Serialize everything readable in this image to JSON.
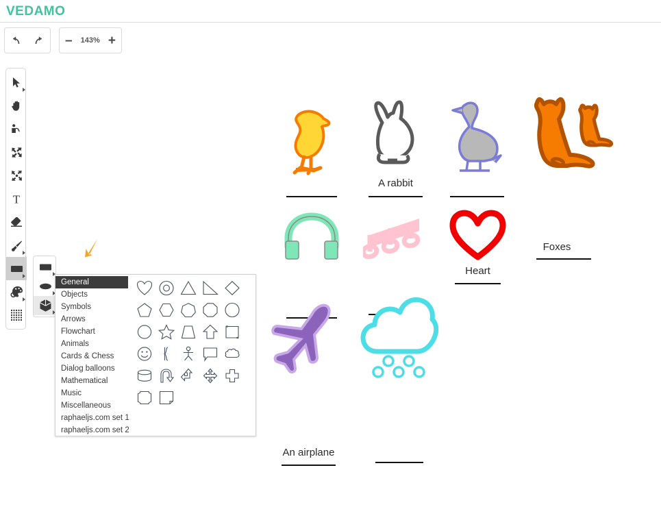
{
  "app": {
    "brand": "VEDAMO",
    "brand_color": "#3ec49f"
  },
  "toolbar": {
    "undo_label": "undo-arrow",
    "redo_label": "redo-arrow",
    "zoom_out_label": "–",
    "zoom_level": "143%",
    "zoom_in_label": "+"
  },
  "tools": [
    {
      "name": "select-pointer",
      "icon": "cursor-arrow-icon",
      "has_submenu": true,
      "selected": false
    },
    {
      "name": "pan-hand",
      "icon": "hand-icon",
      "has_submenu": false,
      "selected": false
    },
    {
      "name": "presenter",
      "icon": "presenter-icon",
      "has_submenu": false,
      "selected": false
    },
    {
      "name": "collapse",
      "icon": "collapse-arrows-icon",
      "has_submenu": false,
      "selected": false
    },
    {
      "name": "expand",
      "icon": "expand-arrows-icon",
      "has_submenu": false,
      "selected": false
    },
    {
      "name": "text",
      "icon": "text-t-icon",
      "has_submenu": false,
      "selected": false
    },
    {
      "name": "eraser",
      "icon": "eraser-icon",
      "has_submenu": false,
      "selected": false
    },
    {
      "name": "brush",
      "icon": "paintbrush-icon",
      "has_submenu": true,
      "selected": false
    },
    {
      "name": "shape",
      "icon": "rectangle-icon",
      "has_submenu": true,
      "selected": true
    },
    {
      "name": "color-palette",
      "icon": "palette-icon",
      "has_submenu": true,
      "selected": false
    },
    {
      "name": "grid",
      "icon": "dotted-grid-icon",
      "has_submenu": false,
      "selected": false
    }
  ],
  "shape_subtools": [
    {
      "name": "rectangle-shape",
      "icon": "filled-rectangle-icon",
      "selected": false
    },
    {
      "name": "ellipse-shape",
      "icon": "filled-ellipse-icon",
      "selected": false
    },
    {
      "name": "cube-shape",
      "icon": "cube-3d-icon",
      "selected": true
    }
  ],
  "shape_panel": {
    "categories": [
      {
        "label": "General",
        "active": true
      },
      {
        "label": "Objects",
        "active": false
      },
      {
        "label": "Symbols",
        "active": false
      },
      {
        "label": "Arrows",
        "active": false
      },
      {
        "label": "Flowchart",
        "active": false
      },
      {
        "label": "Animals",
        "active": false
      },
      {
        "label": "Cards & Chess",
        "active": false
      },
      {
        "label": "Dialog balloons",
        "active": false
      },
      {
        "label": "Mathematical",
        "active": false
      },
      {
        "label": "Music",
        "active": false
      },
      {
        "label": "Miscellaneous",
        "active": false
      },
      {
        "label": "raphaeljs.com set 1",
        "active": false
      },
      {
        "label": "raphaeljs.com set 2",
        "active": false
      }
    ],
    "shapes": [
      "heart-shape-icon",
      "concentric-circle-icon",
      "triangle-icon",
      "right-triangle-icon",
      "diamond-icon",
      "pentagon-icon",
      "hexagon-icon",
      "heptagon-icon",
      "octagon-icon",
      "nonagon-icon",
      "circle-icon",
      "star-icon",
      "trapezoid-icon",
      "up-arrow-icon",
      "document-icon",
      "smiley-face-icon",
      "bracket-icon",
      "stick-figure-icon",
      "speech-bubble-icon",
      "cloud-bubble-icon",
      "cylinder-icon",
      "u-turn-arrow-icon",
      "return-arrow-icon",
      "four-way-arrow-icon",
      "cross-icon",
      "rounded-square-icon",
      "folded-note-icon"
    ]
  },
  "cursor": {
    "name": "orange-arrow-cursor",
    "color": "#f5a623"
  },
  "canvas": {
    "items": [
      {
        "name": "chick-drawing",
        "art": "chick",
        "label": "",
        "fill": "#ffd633",
        "stroke": "#f57c00"
      },
      {
        "name": "rabbit-drawing",
        "art": "rabbit",
        "label": "A rabbit",
        "fill": "#ffffff",
        "stroke": "#5a5a5a"
      },
      {
        "name": "duck-drawing",
        "art": "duck",
        "label": "",
        "fill": "#b8b8b8",
        "stroke": "#7b7bd8"
      },
      {
        "name": "foxes-drawing",
        "art": "foxes",
        "label": "Foxes",
        "fill": "#f57c00",
        "stroke": "#b35300"
      },
      {
        "name": "headphones-drawing",
        "art": "headphones",
        "label": "",
        "fill": "#7fe6b8",
        "stroke": "#8a8a8a"
      },
      {
        "name": "music-notes-drawing",
        "art": "music",
        "label": "",
        "fill": "#ffc4cf",
        "stroke": "#ffc4cf"
      },
      {
        "name": "heart-drawing",
        "art": "heart",
        "label": "Heart",
        "fill": "#ffffff",
        "stroke": "#f00000"
      },
      {
        "name": "airplane-drawing",
        "art": "airplane",
        "label": "An airplane",
        "fill": "#8b63ba",
        "stroke": "#c9a8e8"
      },
      {
        "name": "raincloud-drawing",
        "art": "cloud",
        "label": "",
        "fill": "#ffffff",
        "stroke": "#4ddde6"
      }
    ]
  }
}
